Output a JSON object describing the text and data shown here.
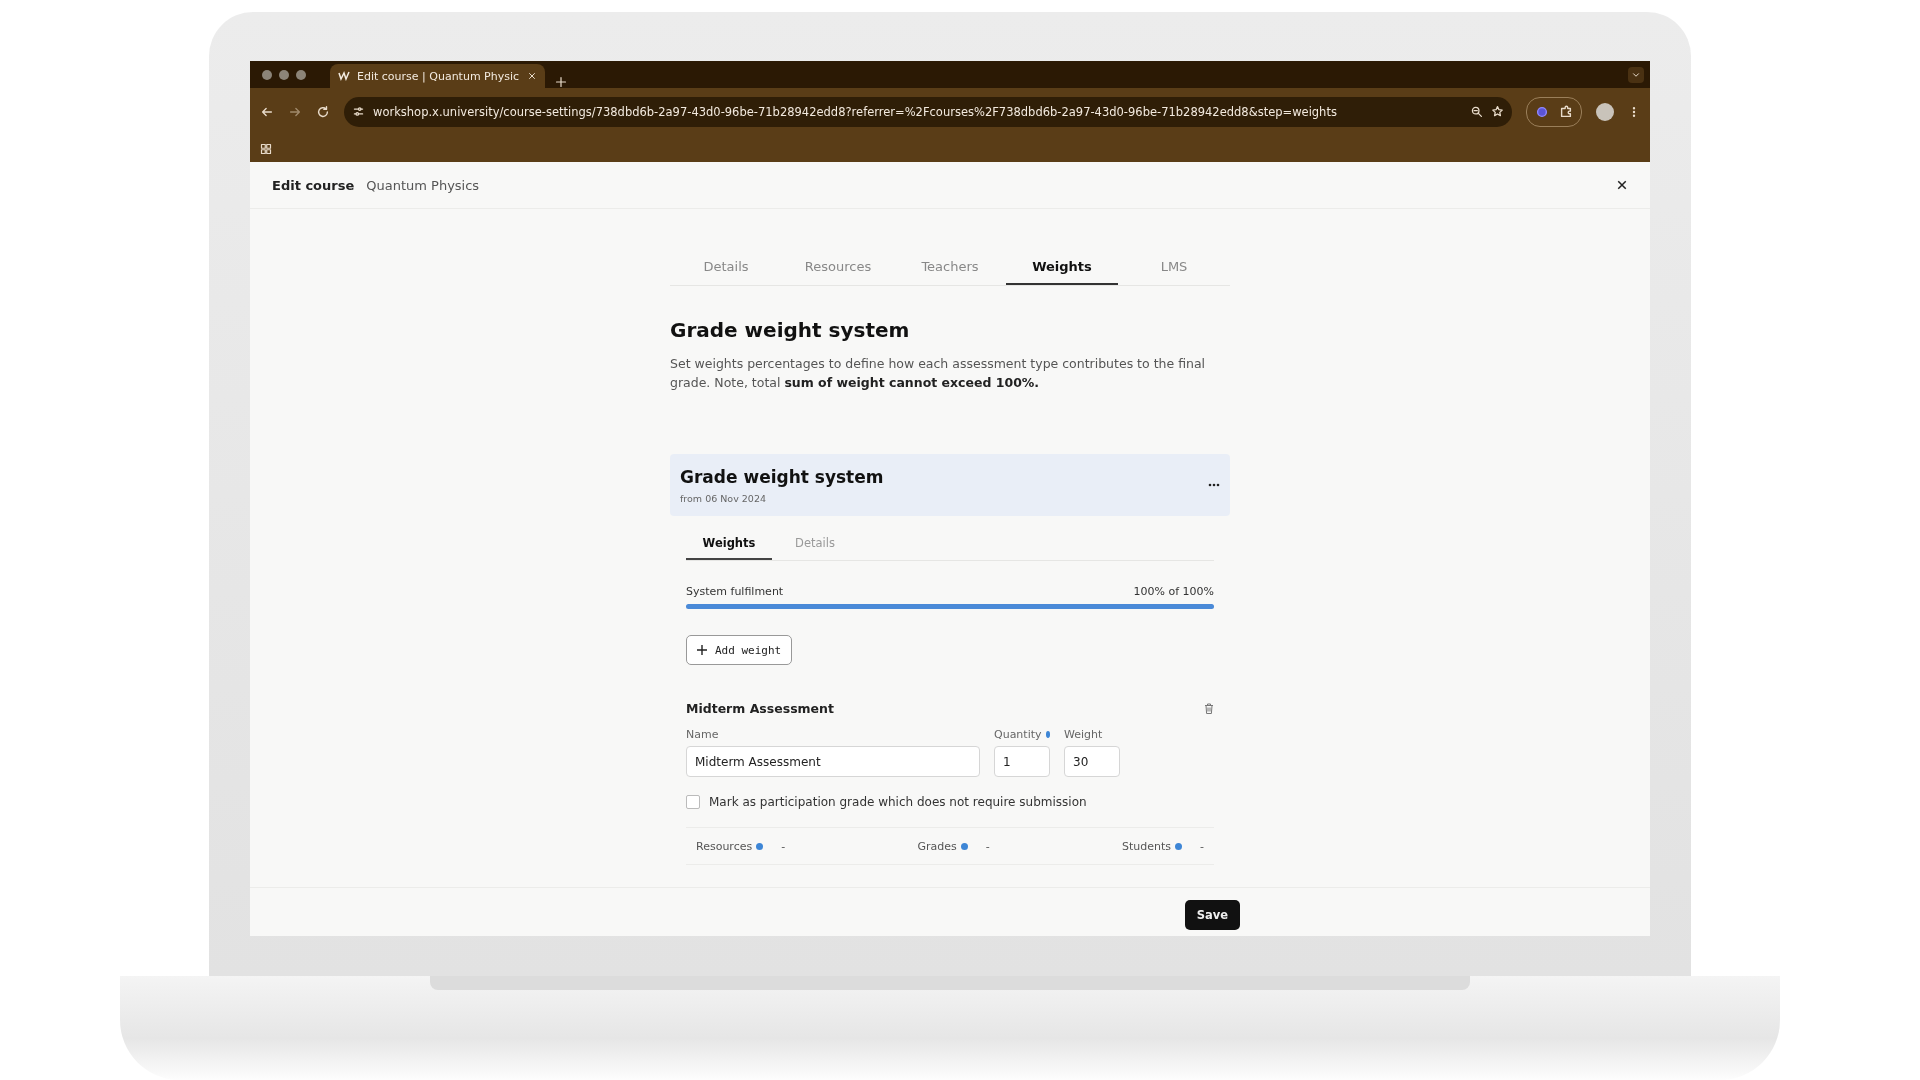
{
  "browser": {
    "tab_title": "Edit course | Quantum Physic",
    "url": "workshop.x.university/course-settings/738dbd6b-2a97-43d0-96be-71b28942edd8?referrer=%2Fcourses%2F738dbd6b-2a97-43d0-96be-71b28942edd8&step=weights"
  },
  "header": {
    "title": "Edit course",
    "course": "Quantum Physics"
  },
  "tabs": [
    {
      "label": "Details",
      "selected": false
    },
    {
      "label": "Resources",
      "selected": false
    },
    {
      "label": "Teachers",
      "selected": false
    },
    {
      "label": "Weights",
      "selected": true
    },
    {
      "label": "LMS",
      "selected": false
    }
  ],
  "heading": "Grade weight system",
  "description": "Set weights percentages to define how each assessment type contributes to the final grade. Note, total **sum of weight cannot exceed 100%.**",
  "card": {
    "title": "Grade weight system",
    "date": "from 06 Nov 2024",
    "tabs": [
      {
        "label": "Weights",
        "selected": true
      },
      {
        "label": "Details",
        "selected": false
      }
    ],
    "progress": {
      "label": "System fulfilment",
      "reading": "100% of 100%",
      "level": 1
    },
    "add_button": "Add weight",
    "weight": {
      "title": "Midterm Assessment",
      "fields": [
        {
          "label": "Name",
          "value": "Midterm Assessment",
          "info": false
        },
        {
          "label": "Quantity",
          "value": "1",
          "info": true
        },
        {
          "label": "Weight",
          "value": "30",
          "info": false
        }
      ],
      "participation": {
        "label": "Mark as participation grade which does not require submission",
        "checked": false
      },
      "stats": [
        {
          "label": "Resources",
          "value": "-"
        },
        {
          "label": "Grades",
          "value": "-"
        },
        {
          "label": "Students",
          "value": "-"
        }
      ]
    }
  },
  "save": "Save"
}
